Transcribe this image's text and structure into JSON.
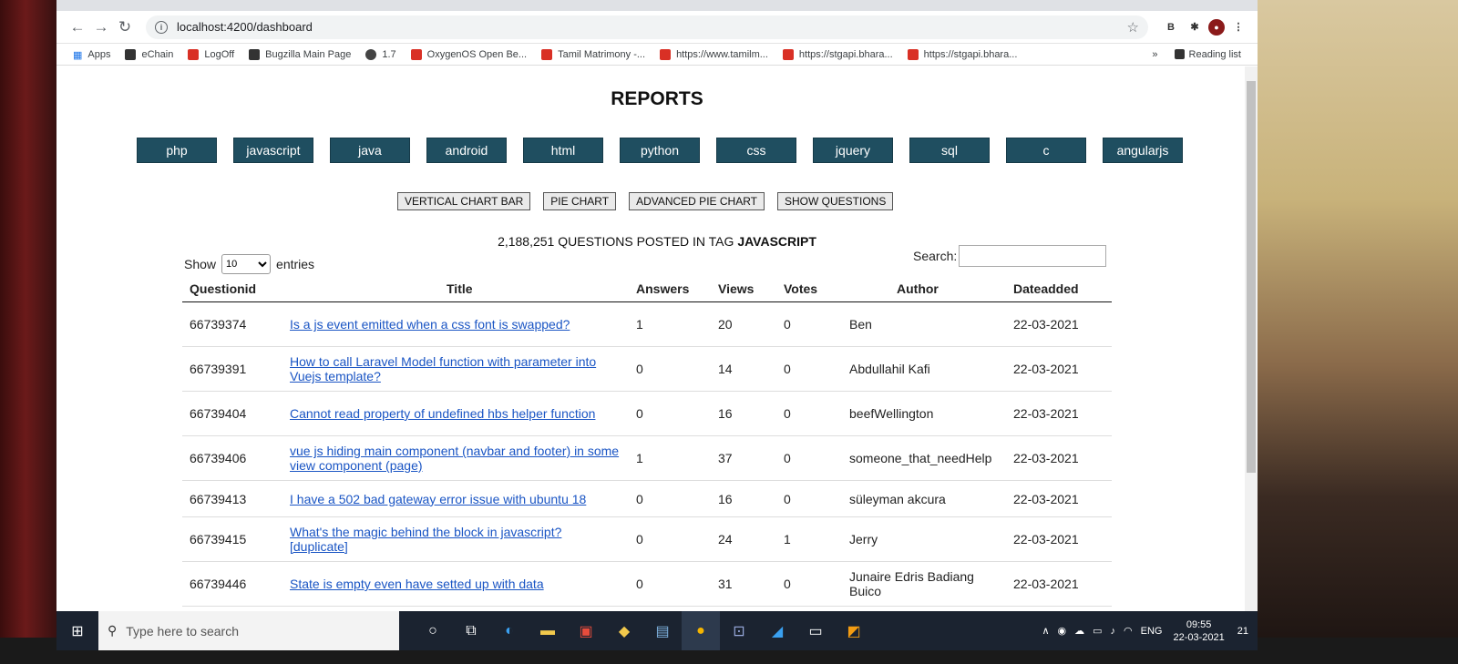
{
  "browser": {
    "url": "localhost:4200/dashboard",
    "back_icon": "arrow-left",
    "forward_icon": "arrow-right",
    "reload_icon": "reload"
  },
  "bookmarks": {
    "items": [
      "Apps",
      "eChain",
      "LogOff",
      "Bugzilla Main Page",
      "1.7",
      "OxygenOS Open Be...",
      "Tamil Matrimony -...",
      "https://www.tamilm...",
      "https://stgapi.bhara...",
      "https://stgapi.bhara..."
    ],
    "overflow": "»",
    "reading_list": "Reading list"
  },
  "page": {
    "title": "REPORTS",
    "tags": [
      "php",
      "javascript",
      "java",
      "android",
      "html",
      "python",
      "css",
      "jquery",
      "sql",
      "c",
      "angularjs"
    ],
    "chart_buttons": [
      "VERTICAL CHART BAR",
      "PIE CHART",
      "ADVANCED PIE CHART",
      "SHOW QUESTIONS"
    ],
    "question_count_prefix": "2,188,251 QUESTIONS POSTED IN TAG ",
    "question_count_tag": "JAVASCRIPT",
    "show_label": "Show",
    "entries_value": "10",
    "entries_label": "entries",
    "search_label": "Search:",
    "search_value": ""
  },
  "table": {
    "columns": [
      "Questionid",
      "Title",
      "Answers",
      "Views",
      "Votes",
      "Author",
      "Dateadded"
    ],
    "rows": [
      {
        "id": "66739374",
        "title": "Is a js event emitted when a css font is swapped?",
        "answers": "1",
        "views": "20",
        "votes": "0",
        "author": "Ben",
        "date": "22-03-2021"
      },
      {
        "id": "66739391",
        "title": "How to call Laravel Model function with parameter into Vuejs template?",
        "answers": "0",
        "views": "14",
        "votes": "0",
        "author": "Abdullahil Kafi",
        "date": "22-03-2021"
      },
      {
        "id": "66739404",
        "title": "Cannot read property of undefined hbs helper function",
        "answers": "0",
        "views": "16",
        "votes": "0",
        "author": "beefWellington",
        "date": "22-03-2021"
      },
      {
        "id": "66739406",
        "title": "vue js hiding main component (navbar and footer) in some view component (page)",
        "answers": "1",
        "views": "37",
        "votes": "0",
        "author": "someone_that_needHelp",
        "date": "22-03-2021"
      },
      {
        "id": "66739413",
        "title": "I have a 502 bad gateway error issue with ubuntu 18",
        "answers": "0",
        "views": "16",
        "votes": "0",
        "author": "süleyman akcura",
        "date": "22-03-2021"
      },
      {
        "id": "66739415",
        "title": "What's the magic behind the block in javascript? [duplicate]",
        "answers": "0",
        "views": "24",
        "votes": "1",
        "author": "Jerry",
        "date": "22-03-2021"
      },
      {
        "id": "66739446",
        "title": "State is empty even have setted up with data",
        "answers": "0",
        "views": "31",
        "votes": "0",
        "author": "Junaire Edris Badiang Buico",
        "date": "22-03-2021"
      }
    ]
  },
  "taskbar": {
    "search_placeholder": "Type here to search",
    "language": "ENG",
    "time": "09:55",
    "date": "22-03-2021",
    "notifications": "21"
  }
}
